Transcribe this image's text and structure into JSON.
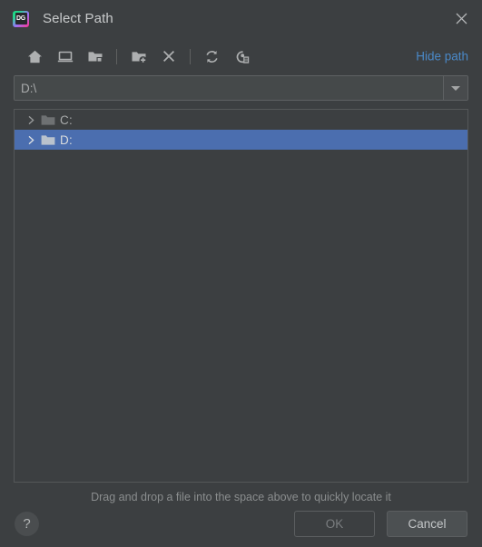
{
  "window": {
    "title": "Select Path",
    "app_icon": "datagrip-icon",
    "icon_glyph": "DG",
    "close_label": "close-icon"
  },
  "toolbar": {
    "buttons": [
      {
        "name": "home-icon",
        "tooltip": "Home"
      },
      {
        "name": "desktop-icon",
        "tooltip": "Desktop"
      },
      {
        "name": "project-folder-icon",
        "tooltip": "Project Directory"
      },
      {
        "name": "new-folder-icon",
        "tooltip": "New Folder"
      },
      {
        "name": "delete-icon",
        "tooltip": "Delete"
      },
      {
        "name": "refresh-icon",
        "tooltip": "Refresh"
      },
      {
        "name": "show-hidden-files-icon",
        "tooltip": "Show Hidden Files and Directories"
      }
    ],
    "hide_path_label": "Hide path",
    "hide_path_color": "#4a88c7"
  },
  "path_field": {
    "value": "D:\\",
    "placeholder": "",
    "dropdown": "chevron-down-icon"
  },
  "tree": {
    "items": [
      {
        "label": "C:",
        "selected": false,
        "expanded": false,
        "icon": "folder-icon"
      },
      {
        "label": "D:",
        "selected": true,
        "expanded": false,
        "icon": "folder-icon"
      }
    ],
    "selection_color": "#4b6eaf"
  },
  "hint": {
    "text": "Drag and drop a file into the space above to quickly locate it"
  },
  "footer": {
    "help_label": "?",
    "ok_label": "OK",
    "ok_enabled": false,
    "cancel_label": "Cancel"
  }
}
